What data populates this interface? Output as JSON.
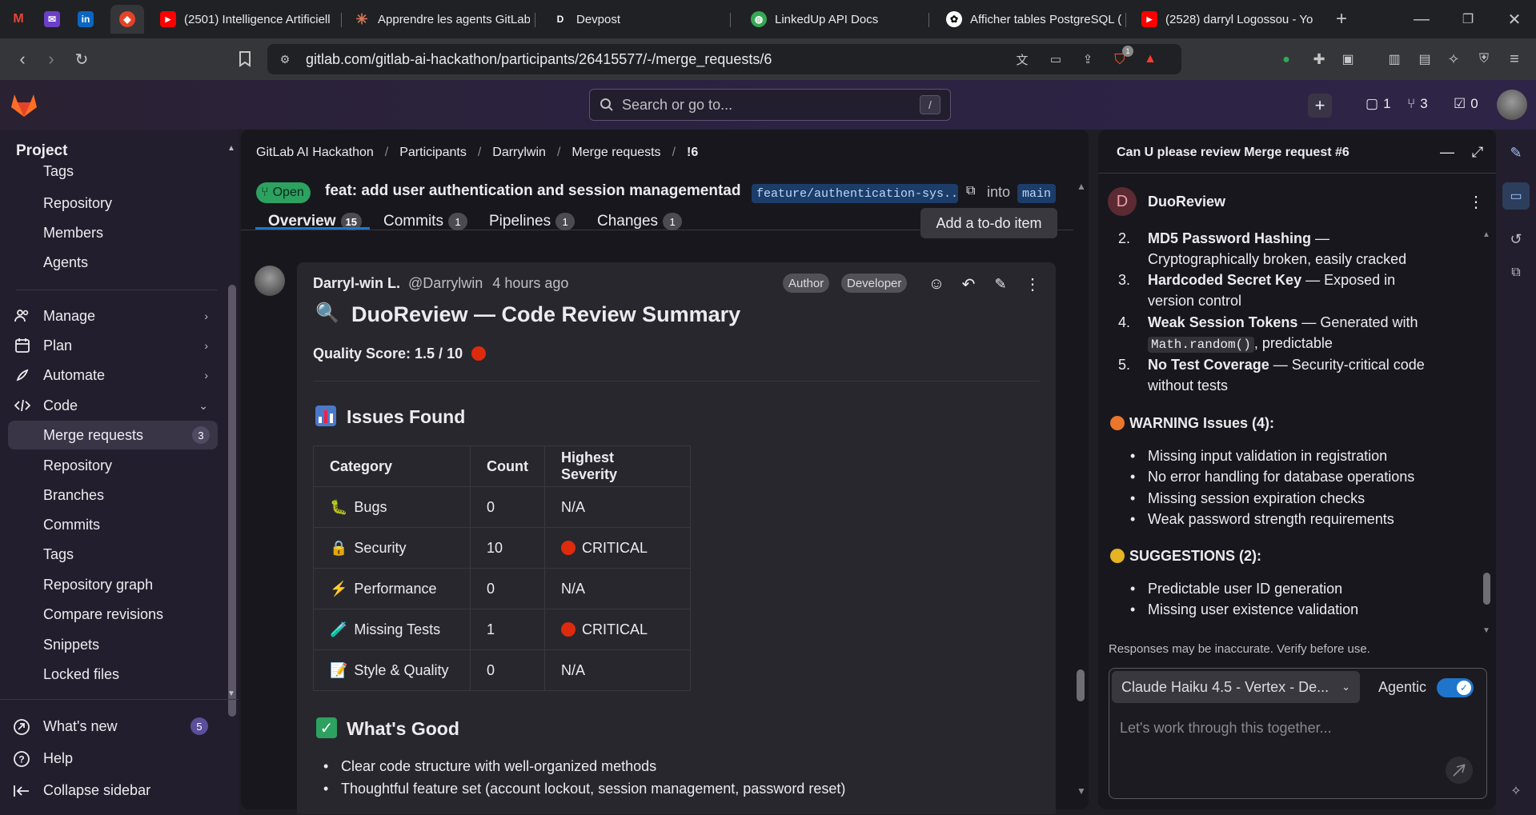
{
  "browser": {
    "tabs": [
      {
        "label": "",
        "icon": "gmail-icon"
      },
      {
        "label": "",
        "icon": "mail-icon"
      },
      {
        "label": "",
        "icon": "linkedin-icon"
      },
      {
        "label": "",
        "icon": "gitlab-icon"
      },
      {
        "label": "(2501) Intelligence Artificiell",
        "icon": "youtube-icon"
      },
      {
        "label": "Apprendre les agents GitLab",
        "icon": "claude-icon"
      },
      {
        "label": "Devpost",
        "icon": "devpost-icon"
      },
      {
        "label": "LinkedUp API Docs",
        "icon": "globe-icon"
      },
      {
        "label": "Afficher tables PostgreSQL (",
        "icon": "chatgpt-icon"
      },
      {
        "label": "(2528) darryl Logossou - Yo",
        "icon": "youtube-icon"
      }
    ],
    "url": "gitlab.com/gitlab-ai-hackathon/participants/26415577/-/merge_requests/6",
    "extension_badge": "1"
  },
  "header": {
    "search_placeholder": "Search or go to...",
    "search_shortcut": "/",
    "issues_count": "1",
    "mr_count": "3",
    "todo_count": "0"
  },
  "sidebar": {
    "title": "Project",
    "items_top": [
      "Tags",
      "Repository",
      "Members",
      "Agents"
    ],
    "groups": [
      {
        "label": "Manage"
      },
      {
        "label": "Plan"
      },
      {
        "label": "Automate"
      },
      {
        "label": "Code"
      }
    ],
    "code_items": [
      {
        "label": "Merge requests",
        "badge": "3"
      },
      {
        "label": "Repository"
      },
      {
        "label": "Branches"
      },
      {
        "label": "Commits"
      },
      {
        "label": "Tags"
      },
      {
        "label": "Repository graph"
      },
      {
        "label": "Compare revisions"
      },
      {
        "label": "Snippets"
      },
      {
        "label": "Locked files"
      }
    ],
    "whats_new": "What's new",
    "whats_new_badge": "5",
    "help": "Help",
    "collapse": "Collapse sidebar"
  },
  "breadcrumb": [
    "GitLab AI Hackathon",
    "Participants",
    "Darrylwin",
    "Merge requests",
    "!6"
  ],
  "mr": {
    "status": "Open",
    "title": "feat: add user authentication and session managementadd...",
    "source_branch": "feature/authentication-sys...",
    "into": "into",
    "target_branch": "main",
    "tabs": [
      {
        "label": "Overview",
        "count": "15"
      },
      {
        "label": "Commits",
        "count": "1"
      },
      {
        "label": "Pipelines",
        "count": "1"
      },
      {
        "label": "Changes",
        "count": "1"
      }
    ],
    "todo_button": "Add a to-do item"
  },
  "comment": {
    "author": "Darryl-win L.",
    "handle": "@Darrylwin",
    "time": "4 hours ago",
    "badges": [
      "Author",
      "Developer"
    ],
    "heading": "DuoReview — Code Review Summary",
    "quality": "Quality Score: 1.5 / 10",
    "issues_heading": "Issues Found",
    "table_headers": [
      "Category",
      "Count",
      "Highest Severity"
    ],
    "table_rows": [
      {
        "category": "Bugs",
        "count": "0",
        "severity": "N/A",
        "icon": "bug-icon"
      },
      {
        "category": "Security",
        "count": "10",
        "severity": "CRITICAL",
        "icon": "lock-icon"
      },
      {
        "category": "Performance",
        "count": "0",
        "severity": "N/A",
        "icon": "lightning-icon"
      },
      {
        "category": "Missing Tests",
        "count": "1",
        "severity": "CRITICAL",
        "icon": "test-tube-icon"
      },
      {
        "category": "Style & Quality",
        "count": "0",
        "severity": "N/A",
        "icon": "memo-icon"
      }
    ],
    "good_heading": "What's Good",
    "good_items": [
      "Clear code structure with well-organized methods",
      "Thoughtful feature set (account lockout, session management, password reset)"
    ]
  },
  "duo": {
    "title": "Can U please review Merge request #6",
    "agent": "DuoReview",
    "agent_initial": "D",
    "critical_items": [
      {
        "n": "2.",
        "bold": "MD5 Password Hashing",
        "rest1": " —",
        "line2": "Cryptographically broken, easily cracked"
      },
      {
        "n": "3.",
        "bold": "Hardcoded Secret Key",
        "rest1": " — Exposed in",
        "line2": "version control"
      },
      {
        "n": "4.",
        "bold": "Weak Session Tokens",
        "rest1": " — Generated with",
        "code": "Math.random()",
        "line2": ", predictable"
      },
      {
        "n": "5.",
        "bold": "No Test Coverage",
        "rest1": " — Security-critical code",
        "line2": "without tests"
      }
    ],
    "warning_heading": "WARNING Issues (4):",
    "warning_items": [
      "Missing input validation in registration",
      "No error handling for database operations",
      "Missing session expiration checks",
      "Weak password strength requirements"
    ],
    "suggestions_heading": "SUGGESTIONS (2):",
    "suggestion_items": [
      "Predictable user ID generation",
      "Missing user existence validation"
    ],
    "disclaimer": "Responses may be inaccurate. Verify before use.",
    "model": "Claude Haiku 4.5 - Vertex - De...",
    "agentic_label": "Agentic",
    "agentic_on": true,
    "input_placeholder": "Let's work through this together..."
  },
  "colors": {
    "accent": "#1f75cb",
    "critical": "#dd2b0e",
    "warning": "#e9762b",
    "suggestion": "#e6b322",
    "open": "#2da160"
  }
}
